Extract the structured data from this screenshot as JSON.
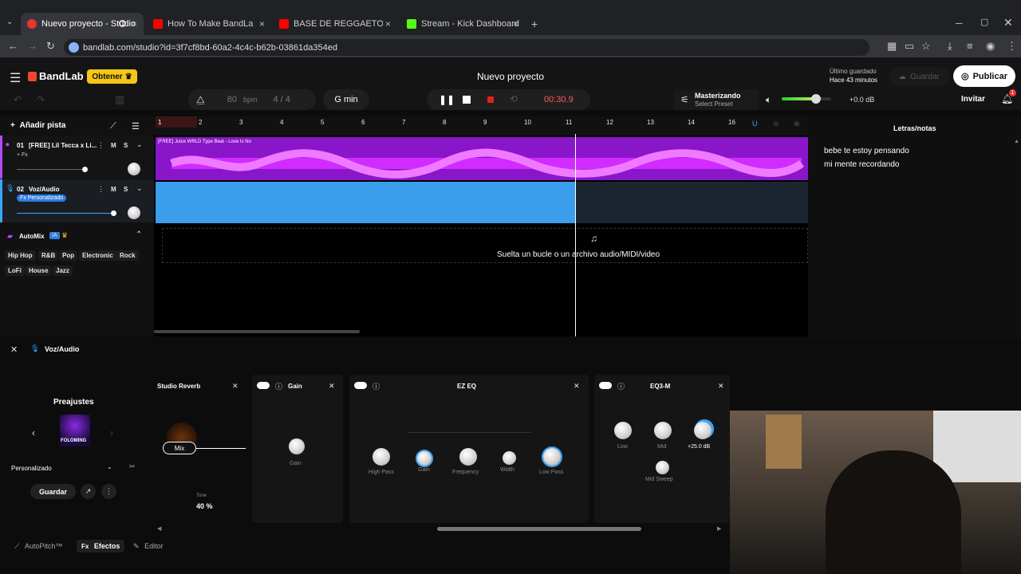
{
  "browser": {
    "tabs": [
      {
        "title": "Nuevo proyecto - Studio"
      },
      {
        "title": "How To Make BandLab AutoTu..."
      },
      {
        "title": "BASE DE REGGAETON USO LIB..."
      },
      {
        "title": "Stream - Kick Dashboard"
      }
    ],
    "url": "bandlab.com/studio?id=3f7cf8bd-60a2-4c4c-b62b-03861da354ed"
  },
  "app": {
    "logo": "BandLab",
    "obtener": "Obtener",
    "project_title": "Nuevo proyecto",
    "bpm_value": "80",
    "bpm_label": "bpm",
    "meter": "4 / 4",
    "key": "G min",
    "time": "00:30.9",
    "mastering_title": "Masterizando",
    "mastering_sub": "Select Preset",
    "volume_db": "+0.0 dB",
    "last_saved_label": "Último guardado",
    "last_saved_time": "Hace 43 minutos",
    "guardar_top": "Guardar",
    "publicar": "Publicar",
    "invitar": "Invitar",
    "notif_count": "1",
    "volume_level": 0.7
  },
  "tracks_panel": {
    "add_track": "Añadir pista",
    "tracks": [
      {
        "number": "01",
        "name": "[FREE] Lil Tecca x Li...",
        "fx": "+ Fx",
        "m": "M",
        "s": "S"
      },
      {
        "number": "02",
        "name": "Voz/Audio",
        "fx": "Fx Personalizado",
        "m": "M",
        "s": "S"
      }
    ],
    "automix": "AutoMix",
    "ia_badge": "IA",
    "genres_row1": [
      "Hip Hop",
      "R&B",
      "Pop",
      "Electronic",
      "Rock"
    ],
    "genres_row2": [
      "LoFi",
      "House",
      "Jazz"
    ]
  },
  "timeline": {
    "bars": [
      "1",
      "2",
      "3",
      "4",
      "5",
      "6",
      "7",
      "8",
      "9",
      "10",
      "11",
      "12",
      "13",
      "14",
      "16"
    ],
    "clip1_title": "[FREE] Juice WRLD Type Beat - Love Is No",
    "drop_text": "Suelta un bucle o un archivo audio/MIDI/video"
  },
  "notes": {
    "title": "Letras/notas",
    "lines": [
      "bebe te estoy pensando",
      "mi mente recordando"
    ]
  },
  "fx_panel": {
    "track_label": "Voz/Audio",
    "presets_title": "Preajustes",
    "preset_art_label": "FOLOMING",
    "preset_selected": "Personalizado",
    "guardar": "Guardar",
    "reverb": {
      "title": "Studio Reverb",
      "mix": "Mix",
      "tone_label": "Tone",
      "tone_value": "40 %"
    },
    "gain": {
      "title": "Gain",
      "knob_label": "Gain"
    },
    "ezeq": {
      "title": "EZ EQ",
      "labels": [
        "High Pass",
        "Gain",
        "Frequency",
        "Width",
        "Low Pass"
      ]
    },
    "eq3m": {
      "title": "EQ3-M",
      "labels": [
        "Low",
        "Mid",
        "+25.0 dB",
        "Mid Sweep"
      ]
    },
    "bottom_tabs": [
      "AutoPitch™",
      "Efectos",
      "Editor"
    ]
  }
}
